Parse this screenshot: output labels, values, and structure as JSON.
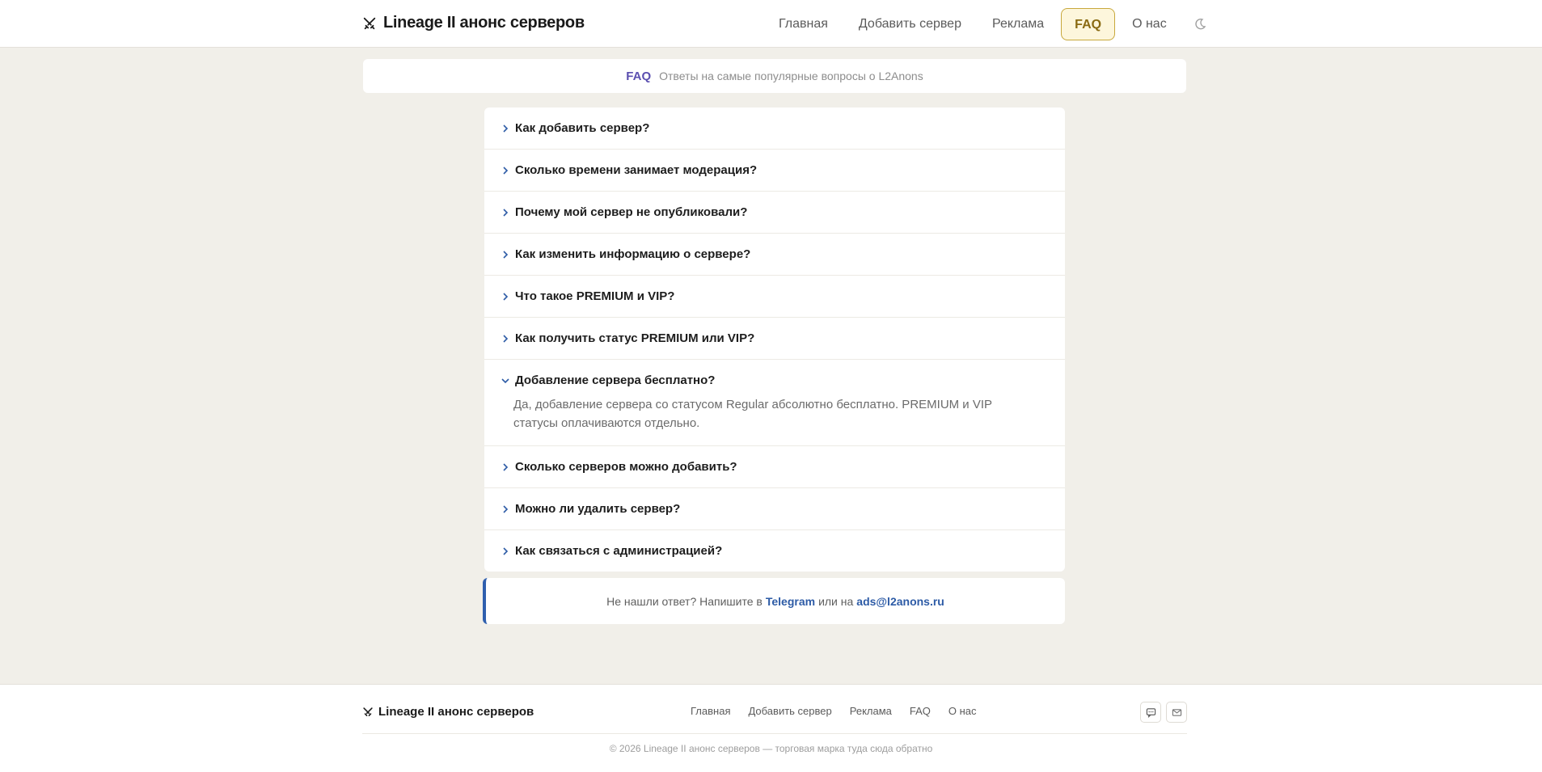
{
  "header": {
    "brand": "Lineage II анонс серверов",
    "nav": [
      {
        "label": "Главная"
      },
      {
        "label": "Добавить сервер"
      },
      {
        "label": "Реклама"
      },
      {
        "label": "FAQ"
      },
      {
        "label": "О нас"
      }
    ],
    "active_nav": "FAQ",
    "theme_icon": "moon-icon"
  },
  "banner": {
    "tag": "FAQ",
    "subtitle": "Ответы на самые популярные вопросы о L2Anons"
  },
  "faq": {
    "items": [
      {
        "question": "Как добавить сервер?",
        "open": false
      },
      {
        "question": "Сколько времени занимает модерация?",
        "open": false
      },
      {
        "question": "Почему мой сервер не опубликовали?",
        "open": false
      },
      {
        "question": "Как изменить информацию о сервере?",
        "open": false
      },
      {
        "question": "Что такое PREMIUM и VIP?",
        "open": false
      },
      {
        "question": "Как получить статус PREMIUM или VIP?",
        "open": false
      },
      {
        "question": "Добавление сервера бесплатно?",
        "open": true,
        "answer": "Да, добавление сервера со статусом Regular абсолютно бесплатно. PREMIUM и VIP статусы оплачиваются отдельно."
      },
      {
        "question": "Сколько серверов можно добавить?",
        "open": false
      },
      {
        "question": "Можно ли удалить сервер?",
        "open": false
      },
      {
        "question": "Как связаться с администрацией?",
        "open": false
      }
    ]
  },
  "help": {
    "prefix": "Не нашли ответ? Напишите в",
    "telegram": "Telegram",
    "middle": "или на",
    "email": "ads@l2anons.ru"
  },
  "footer": {
    "brand": "Lineage II анонс серверов",
    "nav": [
      "Главная",
      "Добавить сервер",
      "Реклама",
      "FAQ",
      "О нас"
    ],
    "icons": [
      "chat-icon",
      "mail-icon"
    ],
    "copyright": "© 2026 Lineage II анонс серверов — торговая марка туда сюда обратно"
  },
  "colors": {
    "background": "#f1efe9",
    "accent_gold": "#c8a83c",
    "accent_blue": "#2d5ba6",
    "accent_purple": "#5b4fb0"
  }
}
